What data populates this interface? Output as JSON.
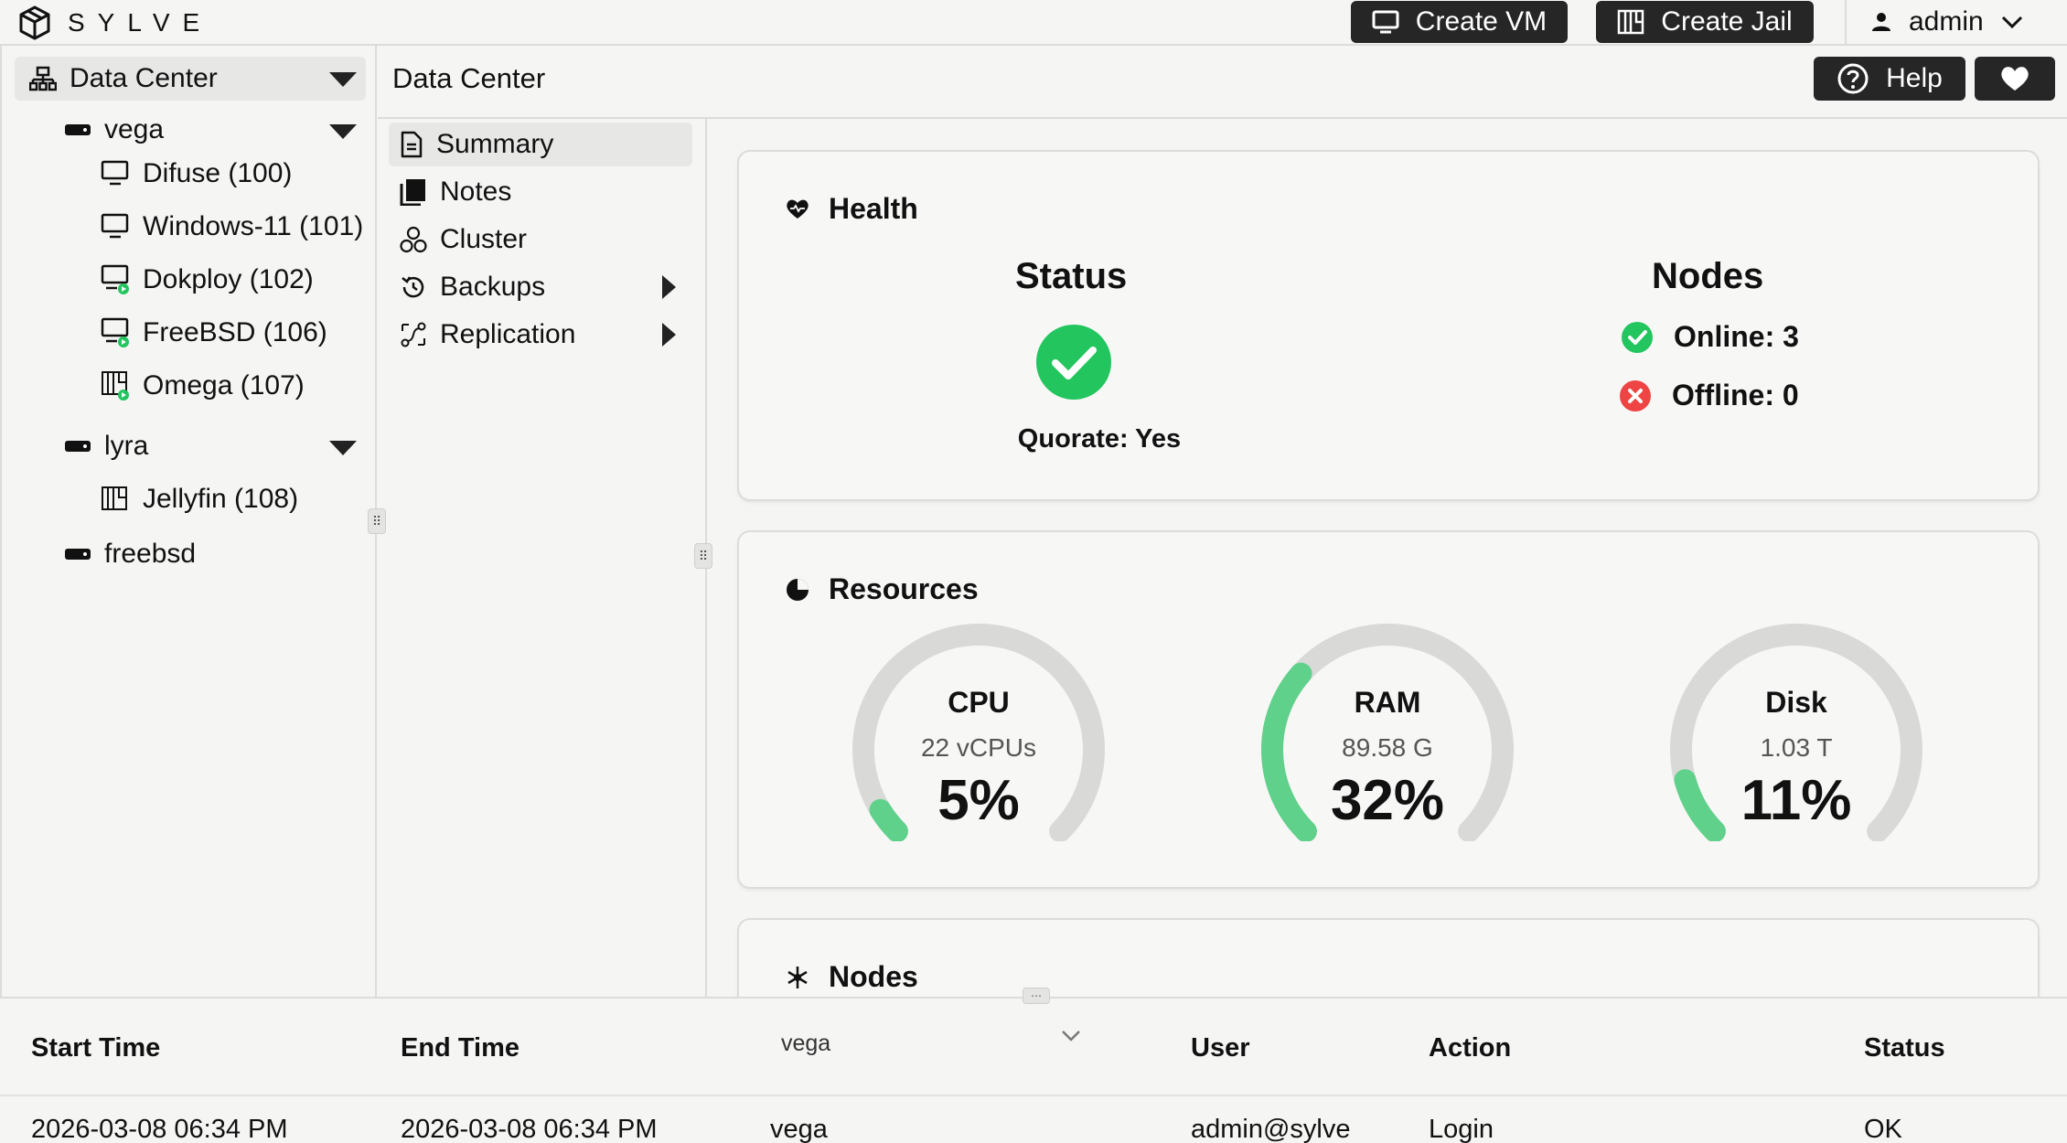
{
  "app": {
    "logo_text": "SYLVE"
  },
  "topbar": {
    "create_vm": "Create VM",
    "create_jail": "Create Jail",
    "user": "admin"
  },
  "tree": {
    "root": "Data Center",
    "items": [
      {
        "label": "vega",
        "type": "node"
      },
      {
        "label": "Difuse (100)",
        "type": "vm",
        "running": false
      },
      {
        "label": "Windows-11 (101)",
        "type": "vm",
        "running": false
      },
      {
        "label": "Dokploy (102)",
        "type": "vm",
        "running": true
      },
      {
        "label": "FreeBSD (106)",
        "type": "vm",
        "running": true
      },
      {
        "label": "Omega (107)",
        "type": "jail",
        "running": true
      },
      {
        "label": "lyra",
        "type": "node"
      },
      {
        "label": "Jellyfin (108)",
        "type": "jail",
        "running": false
      },
      {
        "label": "freebsd",
        "type": "node"
      }
    ]
  },
  "main": {
    "title": "Data Center",
    "help": "Help",
    "nav": [
      {
        "label": "Summary",
        "icon": "document-icon"
      },
      {
        "label": "Notes",
        "icon": "notes-icon"
      },
      {
        "label": "Cluster",
        "icon": "cluster-icon"
      },
      {
        "label": "Backups",
        "icon": "history-icon"
      },
      {
        "label": "Replication",
        "icon": "replication-icon"
      }
    ]
  },
  "health": {
    "title": "Health",
    "status_heading": "Status",
    "quorate": "Quorate: Yes",
    "nodes_heading": "Nodes",
    "online": "Online: 3",
    "offline": "Offline: 0"
  },
  "resources": {
    "title": "Resources",
    "gauges": [
      {
        "label": "CPU",
        "sub": "22 vCPUs",
        "value_text": "5%",
        "value": 5
      },
      {
        "label": "RAM",
        "sub": "89.58 G",
        "value_text": "32%",
        "value": 32
      },
      {
        "label": "Disk",
        "sub": "1.03 T",
        "value_text": "11%",
        "value": 11
      }
    ]
  },
  "nodes_card": {
    "title": "Nodes"
  },
  "table": {
    "headers": {
      "start": "Start Time",
      "end": "End Time",
      "node_filter": "vega",
      "user": "User",
      "action": "Action",
      "status": "Status"
    },
    "rows": [
      {
        "start": "2026-03-08 06:34 PM",
        "end": "2026-03-08 06:34 PM",
        "node": "vega",
        "user": "admin@sylve",
        "action": "Login",
        "status": "OK"
      }
    ]
  },
  "colors": {
    "accent_green": "#22c55e",
    "gauge_green": "#5fd18a",
    "error_red": "#ef4444",
    "dark_button": "#262626"
  }
}
